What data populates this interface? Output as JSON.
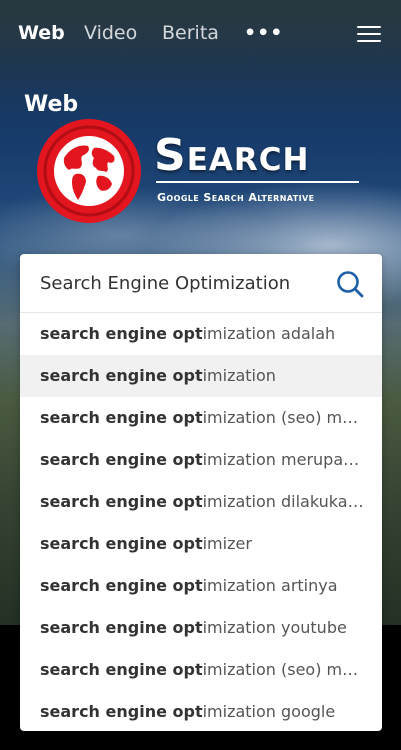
{
  "nav": {
    "tabs": [
      {
        "label": "Web",
        "active": true
      },
      {
        "label": "Video",
        "active": false
      },
      {
        "label": "Berita",
        "active": false
      }
    ],
    "more_label": "•••",
    "more_icon": "more-dots-icon",
    "menu_icon": "hamburger-menu-icon"
  },
  "page": {
    "title": "Web"
  },
  "logo": {
    "word": "Search",
    "tagline": "Google Search Alternative",
    "globe_icon": "globe-icon",
    "colors": {
      "red": "#e3151f",
      "white": "#ffffff"
    }
  },
  "search": {
    "value": "Search Engine Optimization",
    "placeholder": "",
    "icon": "search-icon",
    "accent": "#1f5fa8"
  },
  "suggestions": [
    {
      "bold": "search engine opt",
      "rest": "imization adalah",
      "highlighted": false
    },
    {
      "bold": "search engine opt",
      "rest": "imization",
      "highlighted": true
    },
    {
      "bold": "search engine opt",
      "rest": "imization (seo) mer...",
      "highlighted": false
    },
    {
      "bold": "search engine opt",
      "rest": "imization merupak...",
      "highlighted": false
    },
    {
      "bold": "search engine opt",
      "rest": "imization dilakukan...",
      "highlighted": false
    },
    {
      "bold": "search engine opt",
      "rest": "imizer",
      "highlighted": false
    },
    {
      "bold": "search engine opt",
      "rest": "imization artinya",
      "highlighted": false
    },
    {
      "bold": "search engine opt",
      "rest": "imization youtube",
      "highlighted": false
    },
    {
      "bold": "search engine opt",
      "rest": "imization (seo) mer...",
      "highlighted": false
    },
    {
      "bold": "search engine opt",
      "rest": "imization google",
      "highlighted": false
    }
  ]
}
